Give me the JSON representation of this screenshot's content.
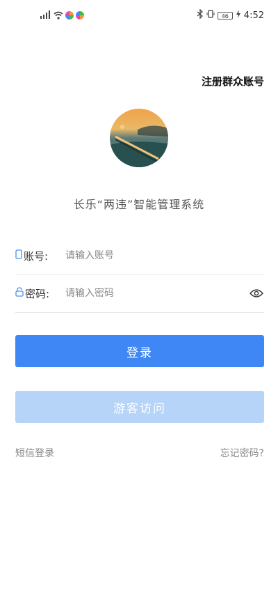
{
  "status_bar": {
    "signal_text": "46",
    "battery_text": "46",
    "time": "4:52"
  },
  "header": {
    "register_label": "注册群众账号"
  },
  "app": {
    "title": "长乐“两违”智能管理系统"
  },
  "form": {
    "account_label": "账号:",
    "account_placeholder": "请输入账号",
    "password_label": "密码:",
    "password_placeholder": "请输入密码"
  },
  "buttons": {
    "login_label": "登录",
    "guest_label": "游客访问"
  },
  "links": {
    "sms_login": "短信登录",
    "forgot_password": "忘记密码?"
  },
  "colors": {
    "primary": "#3f87f5",
    "guest_disabled": "#b6d3f8",
    "icon_blue": "#4a8ef0"
  }
}
